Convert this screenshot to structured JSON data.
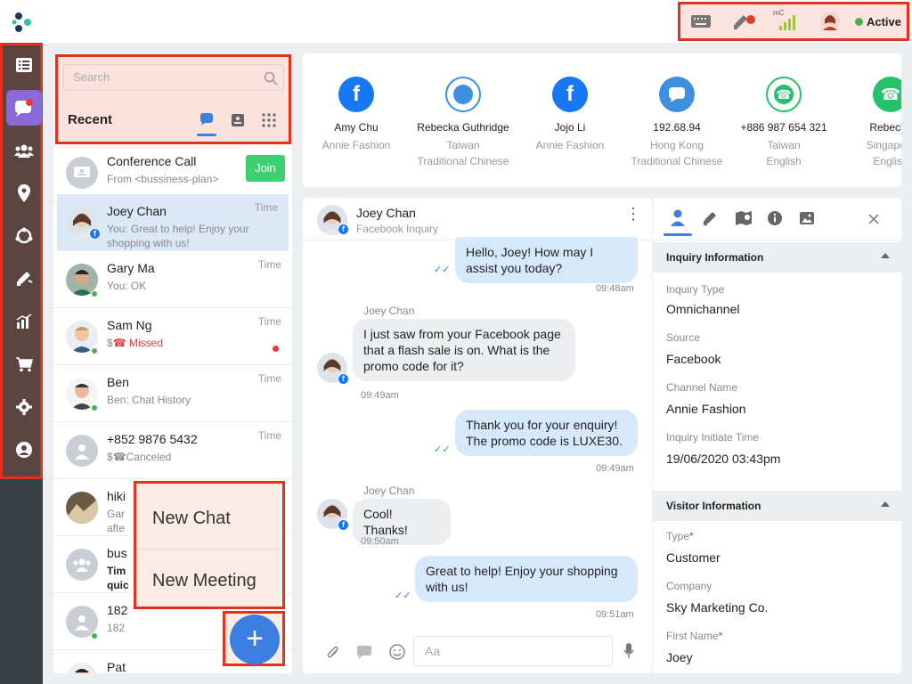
{
  "status_bar": {
    "status_label": "Active",
    "signal_label": "mC"
  },
  "search": {
    "placeholder": "Search"
  },
  "recent_label": "Recent",
  "chats": [
    {
      "name": "Conference Call",
      "sub": "From <bussiness-plan>",
      "time": "",
      "action": "Join"
    },
    {
      "name": "Joey Chan",
      "sub": "You: Great to help! Enjoy your shopping with us!",
      "time": "Time"
    },
    {
      "name": "Gary Ma",
      "sub": "You: OK",
      "time": "Time"
    },
    {
      "name": "Sam Ng",
      "sub": "Missed",
      "sub_prefix": "$",
      "time": "Time"
    },
    {
      "name": "Ben",
      "sub": "Ben: Chat History",
      "time": "Time"
    },
    {
      "name": "+852 9876 5432",
      "sub": "Canceled",
      "sub_prefix": "$",
      "time": "Time"
    },
    {
      "name": "hiki",
      "sub": "Gar",
      "sub2": "afte"
    },
    {
      "name": "bus",
      "sub": "Tim",
      "sub2": "quic"
    },
    {
      "name": "182",
      "sub": "182"
    },
    {
      "name": "Pat"
    }
  ],
  "new_menu": {
    "new_chat": "New Chat",
    "new_meeting": "New Meeting"
  },
  "fab_label": "+",
  "contacts": [
    {
      "name": "Amy Chu",
      "line1": "Annie Fashion",
      "line2": "",
      "icon": "facebook-icon",
      "color": "#1877f2"
    },
    {
      "name": "Rebecka Guthridge",
      "line1": "Taiwan",
      "line2": "Traditional Chinese",
      "icon": "webchat-icon",
      "color": "#3d8fe0"
    },
    {
      "name": "Jojo Li",
      "line1": "Annie Fashion",
      "line2": "",
      "icon": "facebook-icon",
      "color": "#1877f2"
    },
    {
      "name": "192.68.94",
      "line1": "Hong Kong",
      "line2": "Traditional Chinese",
      "icon": "livechat-icon",
      "color": "#3d8fe0"
    },
    {
      "name": "+886 987 654 321",
      "line1": "Taiwan",
      "line2": "English",
      "icon": "phone-icon",
      "color": "#25c06b"
    },
    {
      "name": "Rebecka",
      "line1": "Singapore",
      "line2": "English",
      "icon": "phone-icon",
      "color": "#25c06b"
    }
  ],
  "chat_header": {
    "name": "Joey Chan",
    "sub": "Facebook Inquiry"
  },
  "messages": [
    {
      "dir": "out",
      "text": "Hello, Joey! How may I assist you today?",
      "time": "09:48am"
    },
    {
      "dir": "in",
      "sender": "Joey Chan",
      "text": "I just saw from your Facebook page that a flash sale is on. What is the promo code for it?",
      "time": "09:49am"
    },
    {
      "dir": "out",
      "text": "Thank you for your enquiry! The promo code is LUXE30.",
      "time": "09:49am"
    },
    {
      "dir": "in",
      "sender": "Joey Chan",
      "text": "Cool! Thanks!",
      "time": "09:50am"
    },
    {
      "dir": "out",
      "text": "Great to help! Enjoy your shopping with us!",
      "time": "09:51am"
    }
  ],
  "composer": {
    "placeholder": "Aa"
  },
  "inquiry": {
    "title": "Inquiry Information",
    "fields": [
      {
        "label": "Inquiry Type",
        "value": "Omnichannel"
      },
      {
        "label": "Source",
        "value": "Facebook"
      },
      {
        "label": "Channel Name",
        "value": "Annie Fashion"
      },
      {
        "label": "Inquiry Initiate Time",
        "value": "19/06/2020 03:43pm"
      }
    ]
  },
  "visitor": {
    "title": "Visitor Information",
    "fields": [
      {
        "label": "Type",
        "value": "Customer",
        "required": "*"
      },
      {
        "label": "Company",
        "value": "Sky Marketing Co."
      },
      {
        "label": "First Name",
        "value": "Joey",
        "required": "*"
      }
    ]
  },
  "colors": {
    "accent": "#8a6ad8",
    "highlight": "#e2321d",
    "fab": "#3d7fe0",
    "join": "#3ecf73"
  }
}
